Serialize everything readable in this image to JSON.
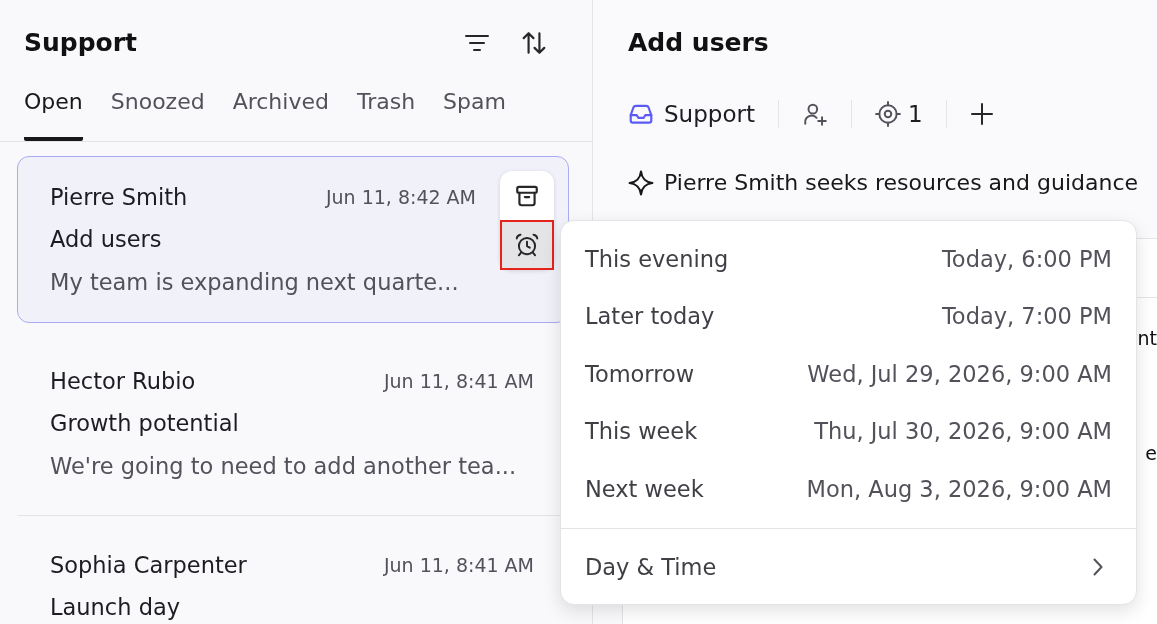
{
  "panel": {
    "title": "Support"
  },
  "tabs": [
    {
      "label": "Open",
      "selected": true
    },
    {
      "label": "Snoozed",
      "selected": false
    },
    {
      "label": "Archived",
      "selected": false
    },
    {
      "label": "Trash",
      "selected": false
    },
    {
      "label": "Spam",
      "selected": false
    }
  ],
  "conversations": [
    {
      "name": "Pierre Smith",
      "time": "Jun 11, 8:42 AM",
      "subject": "Add users",
      "preview": "My team is expanding next quarte...",
      "selected": true,
      "actions": [
        {
          "kind": "archive",
          "highlighted": false
        },
        {
          "kind": "snooze",
          "highlighted": true
        }
      ]
    },
    {
      "name": "Hector Rubio",
      "time": "Jun 11, 8:41 AM",
      "subject": "Growth potential",
      "preview": "We're going to need to add another tea...",
      "selected": false
    },
    {
      "name": "Sophia Carpenter",
      "time": "Jun 11, 8:41 AM",
      "subject": "Launch day",
      "selected": false
    }
  ],
  "detail": {
    "title": "Add users",
    "toolbar": {
      "inbox_label": "Support",
      "target_count": "1"
    },
    "summary": "Pierre Smith seeks resources and guidance",
    "covered_text": [
      "nt",
      "e"
    ]
  },
  "snooze_menu": {
    "options": [
      {
        "kind": "preset",
        "label": "This evening",
        "time": "Today, 6:00 PM"
      },
      {
        "kind": "preset",
        "label": "Later today",
        "time": "Today, 7:00 PM"
      },
      {
        "kind": "preset",
        "label": "Tomorrow",
        "time": "Wed, Jul 29, 2026, 9:00 AM"
      },
      {
        "kind": "preset",
        "label": "This week",
        "time": "Thu, Jul 30, 2026, 9:00 AM"
      },
      {
        "kind": "preset",
        "label": "Next week",
        "time": "Mon, Aug 3, 2026, 9:00 AM"
      },
      {
        "kind": "submenu",
        "label": "Day & Time"
      }
    ]
  }
}
